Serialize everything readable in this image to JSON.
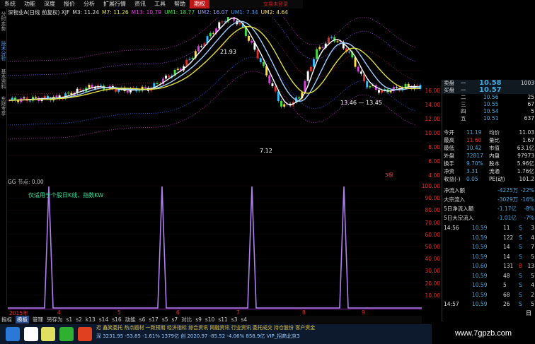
{
  "menu": {
    "items": [
      "系统",
      "功能",
      "深度",
      "报价",
      "分析",
      "扩展行情",
      "资讯",
      "工具",
      "帮助"
    ],
    "active": "期权",
    "right_label": "交易未登录"
  },
  "side_tabs": [
    "分时走势",
    "技术分析",
    "基本资料",
    "东财专享"
  ],
  "kline_header": {
    "title": "深物业A(日线 前复权) XJF",
    "ma": [
      {
        "label": "M3:",
        "value": "11.24",
        "color": "#e0e0e0"
      },
      {
        "label": "M7:",
        "value": "11.26",
        "color": "#e0e040"
      },
      {
        "label": "M13:",
        "value": "10.79",
        "color": "#e040e0"
      },
      {
        "label": "UM1:",
        "value": "18.77",
        "color": "#40e040"
      },
      {
        "label": "UM2:",
        "value": "16.07",
        "color": "#a0a0ff"
      },
      {
        "label": "UM1:",
        "value": "7.34",
        "color": "#40a0ff"
      },
      {
        "label": "UM2:",
        "value": "4.64",
        "color": "#ffe040"
      }
    ]
  },
  "chart_annotations": {
    "high": "21.93",
    "low": "7.12",
    "level_line": "13.46 — 13.45"
  },
  "chart_data": {
    "type": "line",
    "title": "深物业A(日线 前复权)",
    "price_axis": [
      "16.00",
      "14.00",
      "12.00",
      "10.00",
      "8.00",
      "6.00",
      "4.00"
    ],
    "indicator_axis": [
      "100.00",
      "90.00",
      "80.00",
      "70.00",
      "60.00",
      "50.00",
      "40.00",
      "30.00",
      "20.00",
      "10.00"
    ],
    "x_labels": [
      "2015年",
      "4",
      "5",
      "6",
      "7",
      "8",
      "9"
    ],
    "series": [
      {
        "name": "GG",
        "peaks": [
          100,
          100,
          100,
          100,
          100,
          100,
          100,
          100
        ]
      }
    ],
    "ylim": [
      0,
      100
    ]
  },
  "lower": {
    "label": "GG 节点: 0.00",
    "note": "仅适用于个股日K线、指数KW",
    "buy_tag": "3根"
  },
  "bottom_tabs": [
    "指标",
    "模板",
    "管理",
    "另存为",
    "s1",
    "s2",
    "k13",
    "s14",
    "s16",
    "动能",
    "s6",
    "s17",
    "s5",
    "s7",
    "对比",
    "s9",
    "s10",
    "s11",
    "s3",
    "s4"
  ],
  "bottom_tab_selected": "模板",
  "quote": {
    "bid_header": [
      "卖盘",
      "10.58",
      "1003"
    ],
    "ask_header": [
      "买盘",
      "10.57"
    ],
    "levels": [
      [
        "二",
        "10.56",
        "25"
      ],
      [
        "三",
        "10.55",
        "67"
      ],
      [
        "四",
        "10.54",
        "5"
      ],
      [
        "五",
        "10.51",
        "637"
      ]
    ],
    "stats": [
      [
        "今开",
        "11.19",
        "均价",
        "11.03"
      ],
      [
        "最高",
        "11.60",
        "量比",
        "1.67"
      ],
      [
        "最低",
        "10.42",
        "市值",
        "63.1亿"
      ],
      [
        "外盘",
        "72817",
        "内盘",
        "97973"
      ],
      [
        "换手",
        "9.70%",
        "股本",
        "5.96亿"
      ],
      [
        "净资",
        "3.31",
        "流通",
        "1.76亿"
      ],
      [
        "收益(-)",
        "0.05",
        "PE(动)",
        "101.2"
      ]
    ],
    "flows": [
      [
        "净流入额",
        "-4225万",
        "-22%"
      ],
      [
        "大宗流入",
        "-3029万",
        "-16%"
      ],
      [
        "5日净流入额",
        "-1.17亿",
        "-8%"
      ],
      [
        "5日大宗流入",
        "-1.01亿",
        "-7%"
      ]
    ],
    "ticks": [
      [
        "14:56",
        "10.59",
        "11",
        "S",
        "3"
      ],
      [
        "",
        "10.59",
        "122",
        "S",
        "4"
      ],
      [
        "",
        "10.59",
        "14",
        "S",
        "7"
      ],
      [
        "",
        "10.59",
        "14",
        "S",
        "5"
      ],
      [
        "",
        "10.60",
        "131",
        "B",
        "13"
      ],
      [
        "",
        "10.59",
        "48",
        "S",
        "5"
      ],
      [
        "",
        "10.59",
        "5",
        "S",
        "4"
      ],
      [
        "",
        "10.59",
        "68",
        "S",
        "2"
      ],
      [
        "14:57",
        "10.59",
        "26",
        "S",
        "5"
      ]
    ],
    "bottom_tag": "日"
  },
  "ticker": "近 鑫笑委托 热点题材 一致预期 经济指标 综合资讯 网融资讯 行业资讯 委托成交 持仓股份 客户资金",
  "ticker2": "深 3231.95 -53.85 -1.61% 1379亿 创 2020.97 -85.52 -4.06% 858.9亿 VIP_招商北京3",
  "watermark": "www.7gpzb.com"
}
